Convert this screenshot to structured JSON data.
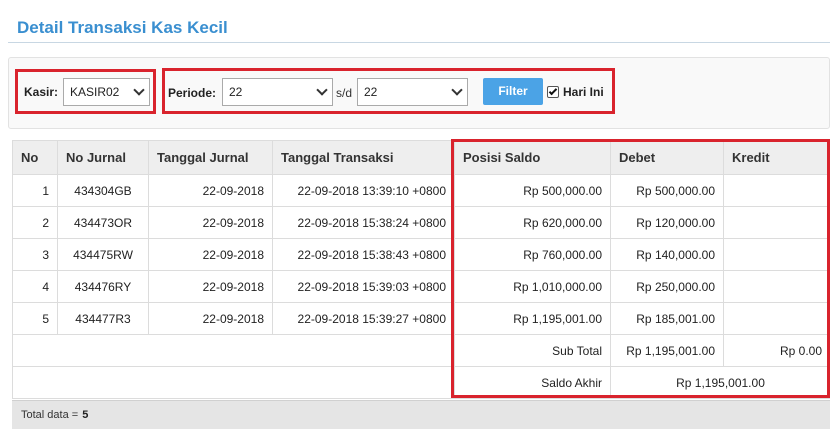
{
  "page": {
    "title": "Detail Transaksi Kas Kecil"
  },
  "filters": {
    "kasir_label": "Kasir:",
    "kasir_value": "KASIR02",
    "periode_label": "Periode:",
    "periode_from": "22",
    "sd_label": "s/d",
    "periode_to": "22",
    "filter_button": "Filter",
    "hari_ini_label": "Hari Ini",
    "hari_ini_checked": true
  },
  "table": {
    "headers": [
      "No",
      "No Jurnal",
      "Tanggal Jurnal",
      "Tanggal Transaksi",
      "Posisi Saldo",
      "Debet",
      "Kredit"
    ],
    "rows": [
      {
        "no": "1",
        "no_jurnal": "434304GB",
        "tgl_jurnal": "22-09-2018",
        "tgl_transaksi": "22-09-2018 13:39:10 +0800",
        "posisi_saldo": "Rp 500,000.00",
        "debet": "Rp 500,000.00",
        "kredit": ""
      },
      {
        "no": "2",
        "no_jurnal": "434473OR",
        "tgl_jurnal": "22-09-2018",
        "tgl_transaksi": "22-09-2018 15:38:24 +0800",
        "posisi_saldo": "Rp 620,000.00",
        "debet": "Rp 120,000.00",
        "kredit": ""
      },
      {
        "no": "3",
        "no_jurnal": "434475RW",
        "tgl_jurnal": "22-09-2018",
        "tgl_transaksi": "22-09-2018 15:38:43 +0800",
        "posisi_saldo": "Rp 760,000.00",
        "debet": "Rp 140,000.00",
        "kredit": ""
      },
      {
        "no": "4",
        "no_jurnal": "434476RY",
        "tgl_jurnal": "22-09-2018",
        "tgl_transaksi": "22-09-2018 15:39:03 +0800",
        "posisi_saldo": "Rp 1,010,000.00",
        "debet": "Rp 250,000.00",
        "kredit": ""
      },
      {
        "no": "5",
        "no_jurnal": "434477R3",
        "tgl_jurnal": "22-09-2018",
        "tgl_transaksi": "22-09-2018 15:39:27 +0800",
        "posisi_saldo": "Rp 1,195,001.00",
        "debet": "Rp 185,001.00",
        "kredit": ""
      }
    ],
    "subtotal_label": "Sub Total",
    "subtotal_debet": "Rp 1,195,001.00",
    "subtotal_kredit": "Rp 0.00",
    "saldo_akhir_label": "Saldo Akhir",
    "saldo_akhir_value": "Rp 1,195,001.00"
  },
  "footer": {
    "total_label": "Total data =",
    "total_value": "5"
  },
  "colors": {
    "title": "#3a8fd0",
    "button": "#4ba3e6",
    "highlight_border": "#d9232d",
    "link": "#2a6aa8"
  },
  "icons": [
    "chevron-down-icon",
    "checkbox-checked-icon"
  ]
}
